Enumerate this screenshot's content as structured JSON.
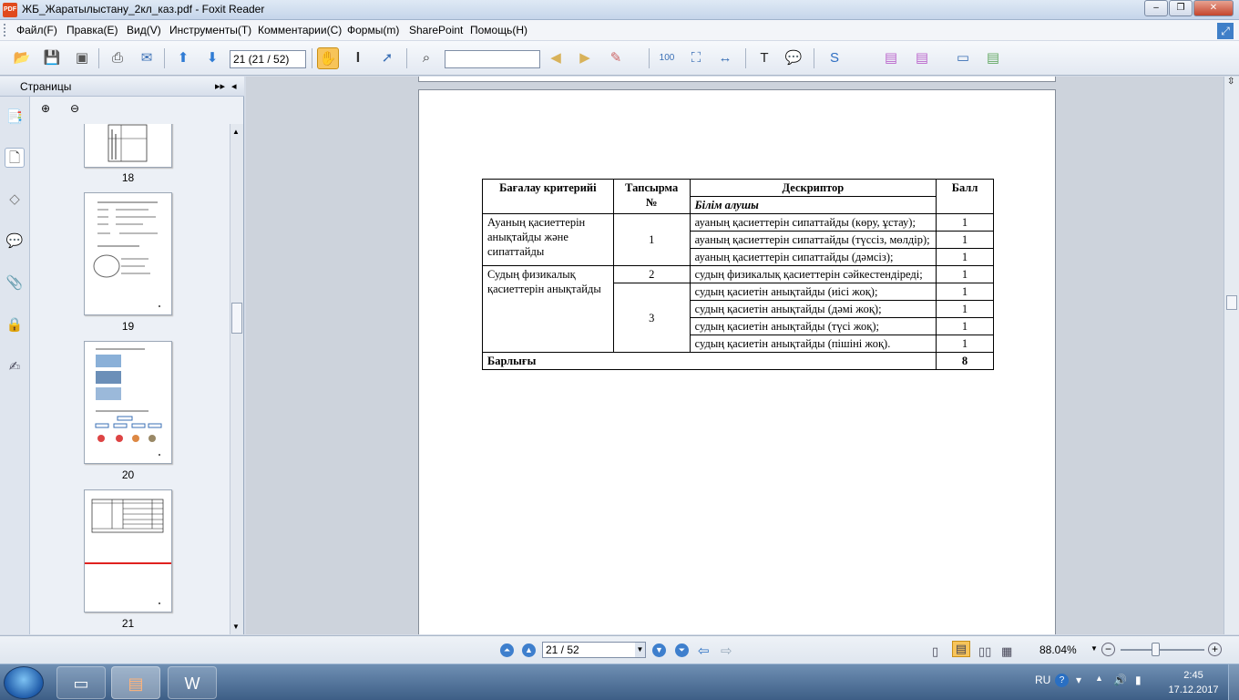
{
  "window": {
    "title": "ЖБ_Жаратылыстану_2кл_каз.pdf - Foxit Reader",
    "app_icon": "PDF"
  },
  "menu": [
    "Файл(F)",
    "Правка(E)",
    "Вид(V)",
    "Инструменты(T)",
    "Комментарии(C)",
    "Формы(m)",
    "SharePoint",
    "Помощь(H)"
  ],
  "toolbar": {
    "page_field": "21 (21 / 52)",
    "search_value": ""
  },
  "sidebar": {
    "title": "Страницы",
    "thumbnails": [
      {
        "label": "18"
      },
      {
        "label": "19"
      },
      {
        "label": "20"
      },
      {
        "label": "21",
        "selected": true
      }
    ]
  },
  "table": {
    "headers": {
      "criteria": "Бағалау критерийі",
      "task": "Тапсырма №",
      "descriptor": "Дескриптор",
      "score": "Балл"
    },
    "subheader": "Білім алушы",
    "rows": [
      {
        "criteria": "Ауаның қасиеттерін анықтайды және сипаттайды",
        "task": "1",
        "descriptor": "ауаның қасиеттерін сипаттайды (көру, ұстау);",
        "score": "1"
      },
      {
        "descriptor": "ауаның қасиеттерін сипаттайды (түссіз, мөлдір);",
        "score": "1"
      },
      {
        "descriptor": "ауаның қасиеттерін сипаттайды (дәмсіз);",
        "score": "1"
      },
      {
        "criteria": "Судың физикалық қасиеттерін анықтайды",
        "task": "2",
        "descriptor": "судың физикалық қасиеттерін сәйкестендіреді;",
        "score": "1"
      },
      {
        "task": "3",
        "descriptor": "судың қасиетін анықтайды (иісі жоқ);",
        "score": "1"
      },
      {
        "descriptor": "судың қасиетін анықтайды (дәмі жоқ);",
        "score": "1"
      },
      {
        "descriptor": "судың қасиетін анықтайды (түсі жоқ);",
        "score": "1"
      },
      {
        "descriptor": "судың қасиетін анықтайды (пішіні жоқ).",
        "score": "1"
      }
    ],
    "total": {
      "label": "Барлығы",
      "score": "8"
    }
  },
  "statusbar": {
    "page_field": "21 / 52",
    "zoom": "88.04%",
    "zoom_level_percent": 88.04
  },
  "taskbar": {
    "lang": "RU",
    "time": "2:45",
    "date": "17.12.2017"
  }
}
